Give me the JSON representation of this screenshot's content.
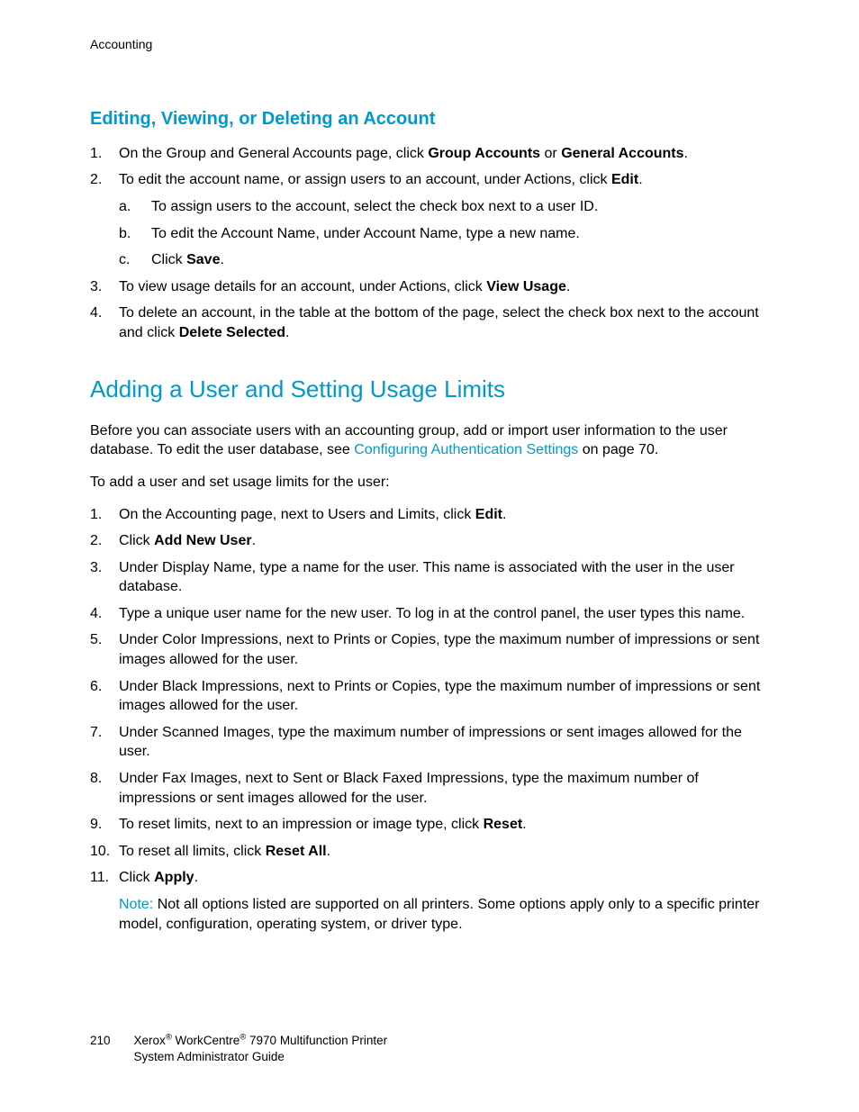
{
  "header": {
    "section": "Accounting"
  },
  "section1": {
    "title": "Editing, Viewing, or Deleting an Account",
    "items": [
      {
        "pre": "On the Group and General Accounts page, click ",
        "b1": "Group Accounts",
        "mid": " or ",
        "b2": "General Accounts",
        "post": "."
      },
      {
        "pre": "To edit the account name, or assign users to an account, under Actions, click ",
        "b1": "Edit",
        "post": ".",
        "sub": [
          {
            "text": "To assign users to the account, select the check box next to a user ID."
          },
          {
            "text": "To edit the Account Name, under Account Name, type a new name."
          },
          {
            "pre": "Click ",
            "b1": "Save",
            "post": "."
          }
        ]
      },
      {
        "pre": "To view usage details for an account, under Actions, click ",
        "b1": "View Usage",
        "post": "."
      },
      {
        "pre": "To delete an account, in the table at the bottom of the page, select the check box next to the account and click ",
        "b1": "Delete Selected",
        "post": "."
      }
    ]
  },
  "section2": {
    "title": "Adding a User and Setting Usage Limits",
    "intro_pre": "Before you can associate users with an accounting group, add or import user information to the user database. To edit the user database, see ",
    "intro_link": "Configuring Authentication Settings",
    "intro_post": " on page 70.",
    "lead": "To add a user and set usage limits for the user:",
    "items": [
      {
        "pre": "On the Accounting page, next to Users and Limits, click ",
        "b1": "Edit",
        "post": "."
      },
      {
        "pre": "Click ",
        "b1": "Add New User",
        "post": "."
      },
      {
        "text": "Under Display Name, type a name for the user. This name is associated with the user in the user database."
      },
      {
        "text": "Type a unique user name for the new user. To log in at the control panel, the user types this name."
      },
      {
        "text": "Under Color Impressions, next to Prints or Copies, type the maximum number of impressions or sent images allowed for the user."
      },
      {
        "text": "Under Black Impressions, next to Prints or Copies, type the maximum number of impressions or sent images allowed for the user."
      },
      {
        "text": "Under Scanned Images, type the maximum number of impressions or sent images allowed for the user."
      },
      {
        "text": "Under Fax Images, next to Sent or Black Faxed Impressions, type the maximum number of impressions or sent images allowed for the user."
      },
      {
        "pre": "To reset limits, next to an impression or image type, click ",
        "b1": "Reset",
        "post": "."
      },
      {
        "pre": "To reset all limits, click ",
        "b1": "Reset All",
        "post": "."
      },
      {
        "pre": "Click ",
        "b1": "Apply",
        "post": "."
      }
    ],
    "note_label": "Note:",
    "note_text": " Not all options listed are supported on all printers. Some options apply only to a specific printer model, configuration, operating system, or driver type."
  },
  "footer": {
    "page": "210",
    "brand1": "Xerox",
    "brand2": " WorkCentre",
    "line1_tail": " 7970 Multifunction Printer",
    "line2": "System Administrator Guide"
  }
}
